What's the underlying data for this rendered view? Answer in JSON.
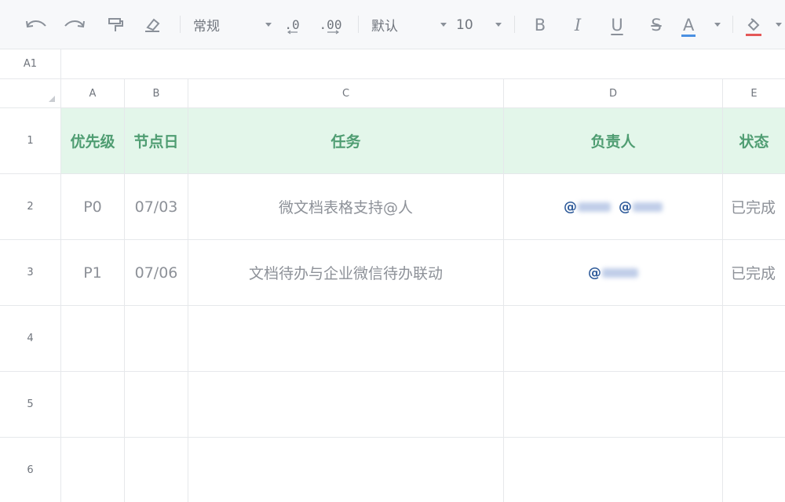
{
  "toolbar": {
    "number_format": "常规",
    "decrease_decimal": ".0",
    "increase_decimal": ".00",
    "font": "默认",
    "font_size": "10",
    "bold": "B",
    "italic": "I",
    "underline": "U",
    "strike": "S",
    "font_color_letter": "A",
    "font_color": "#4a90e2",
    "fill_color": "#e45858"
  },
  "name_box": "A1",
  "columns": [
    "A",
    "B",
    "C",
    "D",
    "E"
  ],
  "rows": [
    "1",
    "2",
    "3",
    "4",
    "5",
    "6"
  ],
  "header": {
    "priority": "优先级",
    "date": "节点日",
    "task": "任务",
    "owner": "负责人",
    "status": "状态"
  },
  "tasks": [
    {
      "priority": "P0",
      "date": "07/03",
      "task": "微文档表格支持@人",
      "owners": [
        "@",
        "@"
      ],
      "status": "已完成"
    },
    {
      "priority": "P1",
      "date": "07/06",
      "task": "文档待办与企业微信待办联动",
      "owners": [
        "@"
      ],
      "status": "已完成"
    }
  ],
  "colors": {
    "header_fill": "#e3f6ea",
    "header_text": "#4f9d72",
    "mention_text": "#2f5b9a"
  }
}
